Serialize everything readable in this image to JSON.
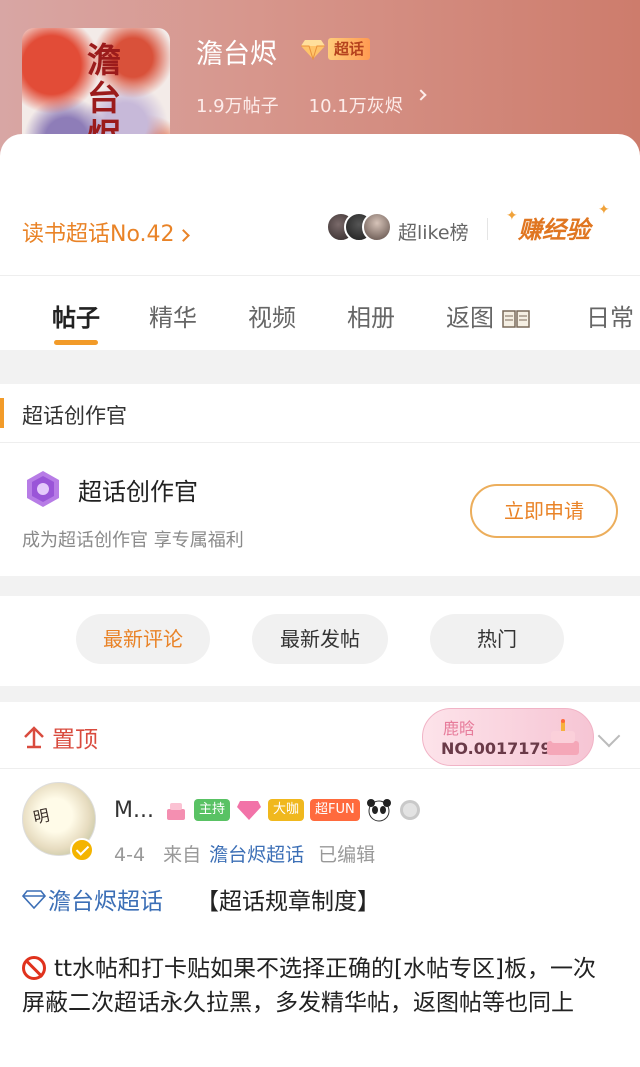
{
  "header": {
    "cover_title": "澹台烬",
    "title": "澹台烬",
    "badge_label": "超话",
    "posts_count": "1.9万帖子",
    "ash_count": "10.1万灰烬"
  },
  "rank_row": {
    "rank_text": "读书超话No.42",
    "superlike_label": "超like榜",
    "earn_label": "赚经验"
  },
  "tabs": [
    {
      "label": "帖子",
      "active": true
    },
    {
      "label": "精华"
    },
    {
      "label": "视频"
    },
    {
      "label": "相册"
    },
    {
      "label": "返图"
    },
    {
      "label": "日常"
    }
  ],
  "creator": {
    "section_title": "超话创作官",
    "title": "超话创作官",
    "subtitle": "成为超话创作官 享专属福利",
    "apply_label": "立即申请"
  },
  "sort": [
    {
      "label": "最新评论",
      "active": true
    },
    {
      "label": "最新发帖"
    },
    {
      "label": "热门"
    }
  ],
  "feed": {
    "pin_label": "置顶",
    "fan_card": {
      "name": "鹿晗",
      "number": "NO.0017179"
    },
    "post": {
      "avatar_text": "明",
      "user_name": "M...",
      "badges": [
        "主持",
        "大咖",
        "超FUN"
      ],
      "date": "4-4",
      "from_label": "来自",
      "source": "澹台烬超话",
      "edited": "已编辑",
      "topic": "澹台烬超话",
      "rule_title": "【超话规章制度】",
      "body": "tt水帖和打卡贴如果不选择正确的[水帖专区]板，一次屏蔽二次超话永久拉黑，多发精华帖，返图帖等也同上"
    }
  },
  "colors": {
    "accent": "#f29b29",
    "link": "#3c6fb6",
    "pin": "#d94b3e"
  }
}
